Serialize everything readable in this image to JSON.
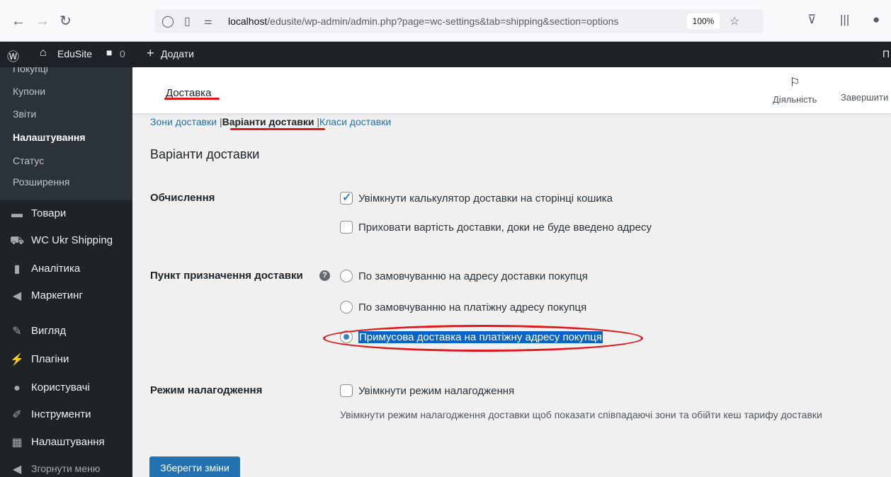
{
  "browser": {
    "url_host": "localhost",
    "url_path": "/edusite/wp-admin/admin.php?page=wc-settings&tab=shipping&section=options",
    "zoom": "100%"
  },
  "admin_bar": {
    "site_name": "EduSite",
    "comments_count": "0",
    "add_new": "Додати",
    "right_partial": "П"
  },
  "sidebar": {
    "submenu": [
      {
        "label": "Покупці",
        "active": false
      },
      {
        "label": "Купони",
        "active": false
      },
      {
        "label": "Звіти",
        "active": false
      },
      {
        "label": "Налаштування",
        "active": true
      },
      {
        "label": "Статус",
        "active": false
      },
      {
        "label": "Розширення",
        "active": false
      }
    ],
    "menu": [
      {
        "label": "Товари",
        "icon": "archive-icon"
      },
      {
        "label": "WC Ukr Shipping",
        "icon": "truck-icon"
      },
      {
        "label": "Аналітика",
        "icon": "bar-chart-icon"
      },
      {
        "label": "Маркетинг",
        "icon": "megaphone-icon"
      },
      {
        "label": "Вигляд",
        "icon": "paintbrush-icon"
      },
      {
        "label": "Плагіни",
        "icon": "plugin-icon"
      },
      {
        "label": "Користувачі",
        "icon": "users-icon"
      },
      {
        "label": "Інструменти",
        "icon": "wrench-icon"
      },
      {
        "label": "Налаштування",
        "icon": "settings-icon"
      },
      {
        "label": "Згорнути меню",
        "icon": "collapse-icon"
      }
    ]
  },
  "wc_header": {
    "title": "Доставка",
    "activity": "Діяльність",
    "finish": "Завершити"
  },
  "subsub": {
    "zones": "Зони доставки",
    "options": "Варіанти доставки",
    "classes": "Класи доставки",
    "sep": "|"
  },
  "page": {
    "heading": "Варіанти доставки",
    "calc_label": "Обчислення",
    "calc_opt1": "Увімкнути калькулятор доставки на сторінці кошика",
    "calc_opt2": "Приховати вартість доставки, доки не буде введено адресу",
    "dest_label": "Пункт призначення доставки",
    "dest_opt1": "По замовчуванню на адресу доставки покупця",
    "dest_opt2": "По замовчуванню на платіжну адресу покупця",
    "dest_opt3": "Примусова доставка на платіжну адресу покупця",
    "debug_label": "Режим налагодження",
    "debug_opt": "Увімкнути режим налагодження",
    "debug_desc": "Увімкнути режим налагодження доставки щоб показати співпадаючі зони та обійти кеш тарифу доставки",
    "save": "Зберегти зміни"
  },
  "colors": {
    "accent": "#2271b1",
    "annotation": "#e21818",
    "admin_bg": "#1d2327"
  }
}
